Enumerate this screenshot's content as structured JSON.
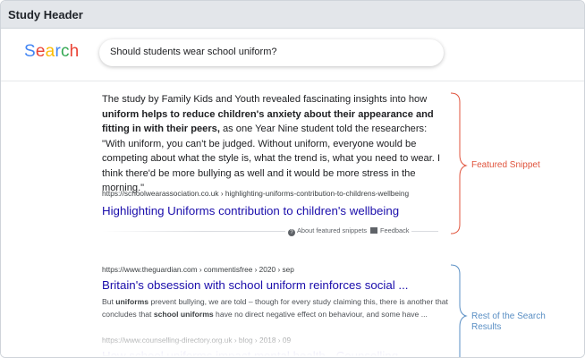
{
  "header": {
    "title": "Study Header"
  },
  "search": {
    "logo_letters": [
      "S",
      "e",
      "a",
      "r",
      "c",
      "h"
    ],
    "query": "Should students wear school uniform?"
  },
  "featured_snippet": {
    "text_parts": [
      {
        "text": "The study by Family Kids and Youth revealed fascinating insights into how ",
        "bold": false
      },
      {
        "text": "uniform helps to reduce children's anxiety about their appearance and fitting in with their peers,",
        "bold": true
      },
      {
        "text": " as one Year Nine student told the researchers: \"With uniform, you can't be judged. Without uniform, everyone would be competing about what the style is, what the trend is, what you need to wear. I think there'd be more bullying as well and it would be more stress in the morning.\"",
        "bold": false
      }
    ],
    "url": "https://schoolwearassociation.co.uk › highlighting-uniforms-contribution-to-childrens-wellbeing",
    "title": "Highlighting Uniforms contribution to children's wellbeing",
    "about_label": "About featured snippets",
    "feedback_label": "Feedback"
  },
  "results": [
    {
      "url": "https://www.theguardian.com › commentisfree › 2020 › sep",
      "title": "Britain's obsession with school uniform reinforces social ...",
      "desc_parts": [
        {
          "text": "But ",
          "bold": false
        },
        {
          "text": "uniforms",
          "bold": true
        },
        {
          "text": " prevent bullying, we are told – though for every study claiming this, there is another that concludes that ",
          "bold": false
        },
        {
          "text": "school uniforms",
          "bold": true
        },
        {
          "text": " have no direct negative effect on behaviour, and some have ...",
          "bold": false
        }
      ]
    },
    {
      "url": "https://www.counselling-directory.org.uk › blog › 2018 › 09",
      "title": "How school uniforms impact mental health - Counselling ..."
    }
  ],
  "annotations": {
    "featured": "Featured Snippet",
    "rest": "Rest of the Search Results"
  },
  "colors": {
    "logo": [
      "#4285f4",
      "#ea4335",
      "#fbbc05",
      "#4285f4",
      "#34a853",
      "#ea4335"
    ],
    "link": "#1a0dab",
    "featured_annotation": "#e0533c",
    "rest_annotation": "#5a8fc4"
  }
}
